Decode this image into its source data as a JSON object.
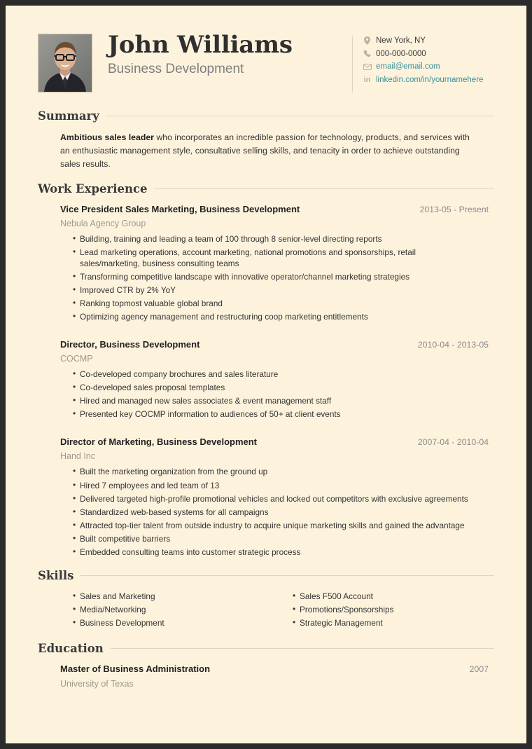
{
  "header": {
    "name": "John Williams",
    "subtitle": "Business Development",
    "photo_alt": "profile-photo",
    "contact": [
      {
        "icon": "location-pin-icon",
        "text": "New York, NY",
        "is_link": false
      },
      {
        "icon": "phone-icon",
        "text": "000-000-0000",
        "is_link": false
      },
      {
        "icon": "envelope-icon",
        "text": "email@email.com",
        "is_link": true
      },
      {
        "icon": "linkedin-icon",
        "text": "linkedin.com/in/yournamehere",
        "is_link": true
      }
    ]
  },
  "summary": {
    "title": "Summary",
    "lead": "Ambitious sales leader",
    "body": " who incorporates an incredible passion for technology, products, and services with an enthusiastic management style, consultative selling skills, and tenacity in order to achieve outstanding sales results."
  },
  "work": {
    "title": "Work Experience",
    "jobs": [
      {
        "title": "Vice President Sales Marketing, Business Development",
        "date": "2013-05 - Present",
        "org": "Nebula Agency Group",
        "bullets": [
          "Building, training and leading a team of 100 through 8 senior-level directing reports",
          "Lead marketing operations, account marketing, national promotions and sponsorships, retail sales/marketing, business consulting teams",
          "Transforming competitive landscape with innovative operator/channel marketing strategies",
          "Improved CTR by 2% YoY",
          "Ranking topmost valuable global brand",
          "Optimizing agency management and restructuring coop marketing entitlements"
        ]
      },
      {
        "title": "Director, Business Development",
        "date": "2010-04 - 2013-05",
        "org": "COCMP",
        "bullets": [
          "Co-developed company brochures and sales literature",
          "Co-developed sales proposal templates",
          "Hired and managed new sales associates & event management staff",
          "Presented key COCMP information to audiences of 50+ at client events"
        ]
      },
      {
        "title": "Director of Marketing, Business Development",
        "date": "2007-04 - 2010-04",
        "org": "Hand Inc",
        "bullets": [
          "Built the marketing organization from the ground up",
          "Hired 7 employees and led team of 13",
          "Delivered targeted high-profile promotional vehicles and locked out competitors with exclusive agreements",
          "Standardized web-based systems for all campaigns",
          "Attracted top-tier talent from outside industry to acquire unique marketing skills and gained the advantage",
          "Built competitive barriers",
          "Embedded consulting teams into customer strategic process"
        ]
      }
    ]
  },
  "skills": {
    "title": "Skills",
    "column_left": [
      "Sales and Marketing",
      "Media/Networking",
      "Business Development"
    ],
    "column_right": [
      "Sales F500 Account",
      "Promotions/Sponsorships",
      "Strategic Management"
    ]
  },
  "education": {
    "title": "Education",
    "entries": [
      {
        "degree": "Master of Business Administration",
        "date": "2007",
        "school": "University of Texas"
      }
    ]
  },
  "theme": {
    "page_background": "#fdf3dd",
    "border": "#2b2b2b",
    "link": "#3f8f96",
    "muted": "#a09a8c",
    "rule": "#ddd5c0"
  }
}
